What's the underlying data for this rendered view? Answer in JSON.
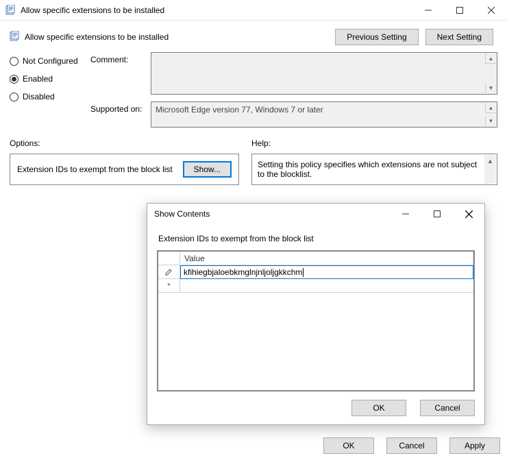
{
  "window": {
    "title": "Allow specific extensions to be installed",
    "subtitle": "Allow specific extensions to be installed",
    "prev_btn": "Previous Setting",
    "next_btn": "Next Setting"
  },
  "radios": {
    "not_configured": "Not Configured",
    "enabled": "Enabled",
    "disabled": "Disabled",
    "selected": "enabled"
  },
  "fields": {
    "comment_label": "Comment:",
    "comment_value": "",
    "supported_label": "Supported on:",
    "supported_value": "Microsoft Edge version 77, Windows 7 or later"
  },
  "panels": {
    "options_label": "Options:",
    "help_label": "Help:",
    "option_item": "Extension IDs to exempt from the block list",
    "show_btn": "Show...",
    "help_text": "Setting this policy specifies which extensions are not subject to the blocklist."
  },
  "footer": {
    "ok": "OK",
    "cancel": "Cancel",
    "apply": "Apply"
  },
  "dialog": {
    "title": "Show Contents",
    "heading": "Extension IDs to exempt from the block list",
    "col_value": "Value",
    "rows": [
      {
        "marker": "pencil",
        "value": "kfihiegbjaloebkmglnjnljoljgkkchm"
      },
      {
        "marker": "star",
        "value": ""
      }
    ],
    "ok": "OK",
    "cancel": "Cancel"
  }
}
